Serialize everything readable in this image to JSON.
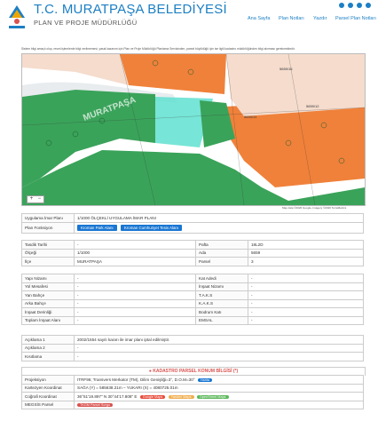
{
  "header": {
    "title": "T.C. MURATPAŞA BELEDİYESİ",
    "subtitle": "PLAN VE PROJE MÜDÜRLÜĞÜ",
    "nav": [
      "Ana Sayfa",
      "Plan Notları",
      "Yazdır",
      "Parsel Plan Notları"
    ],
    "social": [
      "instagram-icon",
      "twitter-icon",
      "facebook-icon",
      "youtube-icon"
    ]
  },
  "notice": "Sistem bilgi amaçlı olup, resmi işlemlerde bilgi verilmemesi, yasal kazanım için Plan ve Proje Müdürlüğü Planlama Servisinden, parsel büyüklüğü için ise ilgili kadastro müdürlüğünden bilgi alınması gerekmektedir.",
  "map": {
    "place_label": "MURATPAŞA",
    "parcel_labels": [
      "5659/16",
      "5659/12",
      "5659/11"
    ],
    "credit": "Map data ©2020 Google, Imagery ©2020 TerraMetrics"
  },
  "plan": {
    "rows": [
      {
        "label": "Uygulama İmar Planı",
        "value": "1/1000 ÖLÇEKLİ UYGULAMA İMAR PLANI"
      },
      {
        "label": "Plan Fonksiyon",
        "buttons": [
          "Kroman Park Alanı",
          "Kroman Cumhuriyet Tesis Alanı"
        ]
      }
    ]
  },
  "info": {
    "left": [
      {
        "label": "Tasdik Tarihi",
        "value": "-"
      },
      {
        "label": "Ölçeği",
        "value": "1/1000"
      },
      {
        "label": "İlçe",
        "value": "MURATPAŞA"
      }
    ],
    "right": [
      {
        "label": "Pafta",
        "value": "18L2D"
      },
      {
        "label": "Ada",
        "value": "5659"
      },
      {
        "label": "Parsel",
        "value": "3"
      }
    ]
  },
  "building": {
    "left": [
      {
        "label": "Yapı Nizamı",
        "value": "-"
      },
      {
        "label": "Yol Mesafesi",
        "value": "-"
      },
      {
        "label": "Yan Bahçe",
        "value": "-"
      },
      {
        "label": "Arka Bahçe",
        "value": "-"
      },
      {
        "label": "İnşaat Derinliği",
        "value": "-"
      },
      {
        "label": "Toplam İnşaat Alanı",
        "value": "-"
      }
    ],
    "right": [
      {
        "label": "Kat Adedi",
        "value": "-"
      },
      {
        "label": "İnşaat Nizamı",
        "value": "-"
      },
      {
        "label": "T.A.K.S",
        "value": "-"
      },
      {
        "label": "K.A.K.S",
        "value": "-"
      },
      {
        "label": "Bodrum Katı",
        "value": "-"
      },
      {
        "label": "EMSAL",
        "value": "-"
      }
    ]
  },
  "notes": [
    {
      "label": "Açıklama 1",
      "value": "2002/1554 sayılı kararı ile imar planı iptal edilmiştir."
    },
    {
      "label": "Açıklama 2",
      "value": "-"
    },
    {
      "label": "Kısıtlama",
      "value": "-"
    }
  ],
  "cadastre": {
    "title": "KADASTRO PARSEL KONUM BİLGİSİ (*)",
    "rows": [
      {
        "label": "Projeksiyon",
        "value": "ITRF96; Transvers Merkator (TM), Dilim Genişliği=3°, D.O.M=30°",
        "badges": [
          {
            "text": "Harita",
            "color": "#1976d2"
          }
        ]
      },
      {
        "label": "Kartezyen Koordinat",
        "value": "SAĞA (Y) = 585638.21m – YUKARI (X) = 4080725.01m",
        "badges": []
      },
      {
        "label": "Coğrafi Koordinat",
        "value": "36°51'19.897\" N 30°44'17.808\" E",
        "badges": [
          {
            "text": "Google Maps",
            "color": "#e74c3c"
          },
          {
            "text": "Yandex Maps",
            "color": "#f0ad4e"
          },
          {
            "text": "OpenStreet Maps",
            "color": "#5cb85c"
          }
        ]
      },
      {
        "label": "MEGSİS Parsel",
        "value": "",
        "badges": [
          {
            "text": "TKGM Parsel Sorgu",
            "color": "#d9534f"
          }
        ]
      }
    ]
  },
  "colors": {
    "brand": "#1b7fc4",
    "button": "#1976d2",
    "park": "#3aa35a",
    "residential": "#f0813a",
    "road": "#f2d7c8"
  }
}
